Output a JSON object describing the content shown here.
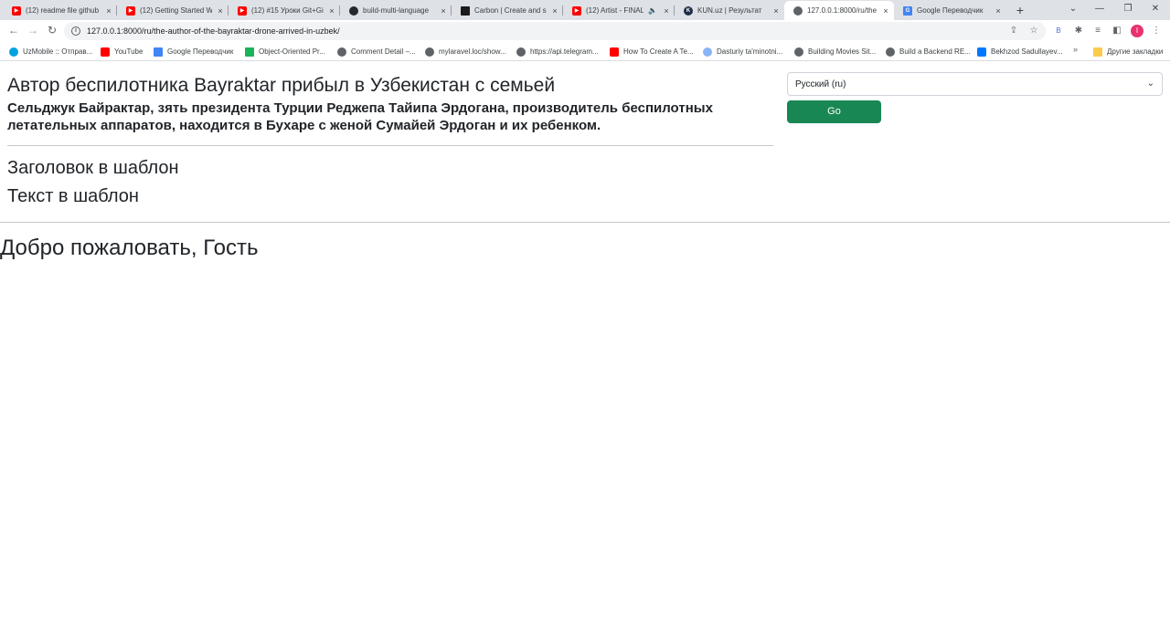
{
  "browser": {
    "tabs": [
      {
        "title": "(12) readme file github",
        "icon": "youtube-icon",
        "active": false
      },
      {
        "title": "(12) Getting Started W",
        "icon": "youtube-icon",
        "active": false
      },
      {
        "title": "(12) #15 Уроки Git+Gi",
        "icon": "youtube-icon",
        "active": false
      },
      {
        "title": "build-multi-language",
        "icon": "github-icon",
        "active": false
      },
      {
        "title": "Carbon | Create and sh",
        "icon": "carbon-icon",
        "active": false
      },
      {
        "title": "(12) Artist - FINAL",
        "icon": "youtube-icon",
        "active": false
      },
      {
        "title": "KUN.uz | Результат",
        "icon": "kun-icon",
        "active": false
      },
      {
        "title": "127.0.0.1:8000/ru/the",
        "icon": "globe-icon",
        "active": true
      },
      {
        "title": "Google Переводчик",
        "icon": "google-translate-icon",
        "active": false
      }
    ],
    "url": "127.0.0.1:8000/ru/the-author-of-the-bayraktar-drone-arrived-in-uzbek/",
    "profile_initial": "I",
    "extension_letter": "B",
    "bookmarks": [
      {
        "label": "UzMobile :: Отправ...",
        "icon": "uzmobile-icon"
      },
      {
        "label": "YouTube",
        "icon": "youtube-icon"
      },
      {
        "label": "Google Переводчик",
        "icon": "google-translate-icon"
      },
      {
        "label": "Object-Oriented Pr...",
        "icon": "bookmark-green-icon"
      },
      {
        "label": "Comment Detail –...",
        "icon": "globe-icon"
      },
      {
        "label": "mylaravel.loc/show...",
        "icon": "globe-icon"
      },
      {
        "label": "https://api.telegram...",
        "icon": "globe-icon"
      },
      {
        "label": "How To Create A Te...",
        "icon": "youtube-icon"
      },
      {
        "label": "Dasturiy ta'minotni...",
        "icon": "bookmark-blue-icon"
      },
      {
        "label": "Building Movies Sit...",
        "icon": "globe-icon"
      },
      {
        "label": "Build a Backend RE...",
        "icon": "globe-icon"
      },
      {
        "label": "Bekhzod Sadullayev...",
        "icon": "vk-icon"
      }
    ],
    "bookmarks_overflow": "»",
    "other_bookmarks": "Другие закладки"
  },
  "article": {
    "headline": "Автор беспилотника Bayraktar прибыл в Узбекистан с семьей",
    "lead": "Сельджук Байрактар, зять президента Турции Реджепа Тайипа Эрдогана, производитель беспилотных летательных аппаратов, находится в Бухаре с женой Сумайей Эрдоган и их ребенком."
  },
  "template": {
    "title": "Заголовок в шаблон",
    "text": "Текст в шаблон"
  },
  "welcome": "Добро пожаловать, Гость",
  "language_form": {
    "selected": "Русский (ru)",
    "button": "Go"
  },
  "colors": {
    "go_button": "#198754",
    "profile": "#e8336e"
  }
}
